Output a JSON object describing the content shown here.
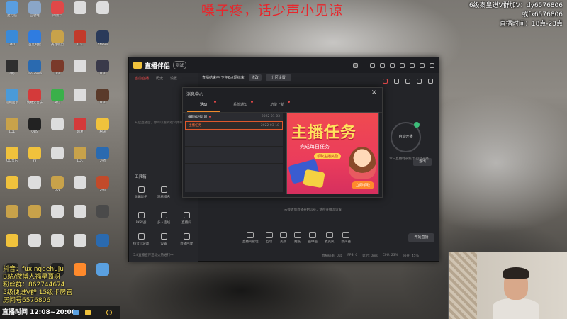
{
  "overlay": {
    "top_banner": "嗓子疼，话少声小见谅",
    "right_lines": [
      "6级秦皇进V群加V：dy6576806",
      "或fx6576806",
      "直播时间：18点-23点"
    ],
    "streamer_lines": [
      "抖音：fuxinggehuju",
      "B站/微博人福星哥呀",
      "粉丝群：862744674",
      "5级便进V群 15级卡房管",
      "房间号6576806"
    ],
    "live_time": "直播时间 12:08~20:00"
  },
  "desktop": {
    "icons": [
      {
        "label": "此电脑",
        "color": "#5a9ee0"
      },
      {
        "label": "回收站",
        "color": "#8aa6c8"
      },
      {
        "label": "网易云",
        "color": "#e04848"
      },
      {
        "label": "",
        "color": "#dddddd"
      },
      {
        "label": "",
        "color": "#dddddd"
      },
      {
        "label": "360",
        "color": "#3a8ad8"
      },
      {
        "label": "百度网盘",
        "color": "#2f7ce0"
      },
      {
        "label": "英雄联盟",
        "color": "#c8a24a"
      },
      {
        "label": "LOL",
        "color": "#c23a2a"
      },
      {
        "label": "Steam",
        "color": "#2a3a5a"
      },
      {
        "label": "QQ",
        "color": "#2f2f2f"
      },
      {
        "label": "WeGame",
        "color": "#2a6ab0"
      },
      {
        "label": "LOL",
        "color": "#7a3a2a"
      },
      {
        "label": "",
        "color": "#dddddd"
      },
      {
        "label": "LOL",
        "color": "#3a3a4a"
      },
      {
        "label": "控制面板",
        "color": "#4a9ad8"
      },
      {
        "label": "网易云音乐",
        "color": "#d43a3a"
      },
      {
        "label": "微信",
        "color": "#3ab04a"
      },
      {
        "label": "",
        "color": "#dddddd"
      },
      {
        "label": "LOL",
        "color": "#5a3a2a"
      },
      {
        "label": "LOL",
        "color": "#c8a24a"
      },
      {
        "label": "OBS",
        "color": "#222222"
      },
      {
        "label": "",
        "color": "#dddddd"
      },
      {
        "label": "网易",
        "color": "#d43a3a"
      },
      {
        "label": "腾讯",
        "color": "#f0c23c"
      },
      {
        "label": "QQ音乐",
        "color": "#f0c23c"
      },
      {
        "label": "YY",
        "color": "#f0c23c"
      },
      {
        "label": "",
        "color": "#dddddd"
      },
      {
        "label": "LOL",
        "color": "#c8a24a"
      },
      {
        "label": "游戏",
        "color": "#2a6ab0"
      },
      {
        "label": "",
        "color": "#f0c23c"
      },
      {
        "label": "",
        "color": "#dddddd"
      },
      {
        "label": "LOL",
        "color": "#c8a24a"
      },
      {
        "label": "",
        "color": "#dddddd"
      },
      {
        "label": "游戏",
        "color": "#c24a2a"
      },
      {
        "label": "",
        "color": "#c8a24a"
      },
      {
        "label": "",
        "color": "#c8a24a"
      },
      {
        "label": "",
        "color": "#dddddd"
      },
      {
        "label": "",
        "color": "#dddddd"
      },
      {
        "label": "",
        "color": "#4a4a4a"
      },
      {
        "label": "",
        "color": "#f0c23c"
      },
      {
        "label": "",
        "color": "#dddddd"
      },
      {
        "label": "",
        "color": "#dddddd"
      },
      {
        "label": "",
        "color": "#dddddd"
      },
      {
        "label": "",
        "color": "#2a6ab0"
      },
      {
        "label": "",
        "color": "#2a2a2a"
      },
      {
        "label": "",
        "color": "#2a2a2a"
      },
      {
        "label": "",
        "color": "#222222"
      },
      {
        "label": "",
        "color": "#ff8a2c"
      },
      {
        "label": "",
        "color": "#5aa0e0"
      }
    ]
  },
  "app": {
    "title": "直播伴侣",
    "version_badge": "测试",
    "left_tabs": [
      "当前直播",
      "历史",
      "设置"
    ],
    "left_empty": "开启直播后，你可以看到观众弹幕",
    "tools_heading": "工具箱",
    "tools": [
      "弹幕助手",
      "观看排名",
      "PK对战",
      "多人连线",
      "直播间",
      "抖音小游戏",
      "设置",
      "直播回放",
      "高级设置"
    ],
    "left_bottom": "5.8直播宣传活动火热进行中",
    "header_status": "直播结束中 下午6点场结束",
    "header_chip": "修改",
    "header_chip2": "分区设置",
    "exit_label": "退出",
    "ring_label": "自动开播",
    "ring_note": "今日直播时长统计 自动开播",
    "hint": "未接收到直播开始信号，请检查推流设置",
    "bottom_tools": [
      "直播间管理",
      "互动",
      "美颜",
      "贴纸",
      "画中画",
      "麦克风",
      "扬声器"
    ],
    "start_label": "开始直播",
    "status_items": [
      "直播码率: 0kb",
      "FPS: 0",
      "延迟: 0ms",
      "CPU: 23%",
      "内存: 45%"
    ]
  },
  "modal": {
    "title": "消息中心",
    "close": "×",
    "tabs": [
      {
        "label": "活动",
        "active": true
      },
      {
        "label": "系统通知",
        "active": false
      },
      {
        "label": "功能上新",
        "active": false
      }
    ],
    "rows": [
      {
        "name": "每日福利计划",
        "date": "2022-01-03",
        "selected": false,
        "dot": true
      },
      {
        "name": "主播任务",
        "date": "2022-03-18",
        "selected": true,
        "dot": false
      }
    ],
    "banner": {
      "title": "主播任务",
      "subtitle": "完成每日任务",
      "ribbon": "领取主播奖励",
      "button": "立即领取"
    }
  }
}
